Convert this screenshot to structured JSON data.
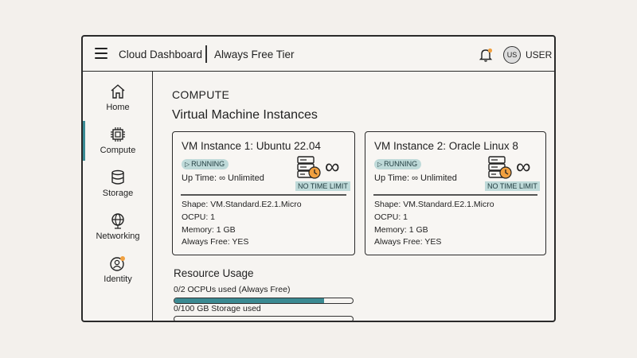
{
  "header": {
    "app_title": "Cloud Dashboard",
    "tier_label": "Always Free Tier",
    "user_initials": "US",
    "user_label": "USER"
  },
  "sidebar": {
    "items": [
      {
        "label": "Home",
        "icon": "home-icon",
        "active": false
      },
      {
        "label": "Compute",
        "icon": "cpu-chip-icon",
        "active": true
      },
      {
        "label": "Storage",
        "icon": "database-icon",
        "active": false
      },
      {
        "label": "Networking",
        "icon": "globe-icon",
        "active": false
      },
      {
        "label": "Identity",
        "icon": "user-badge-icon",
        "active": false
      }
    ]
  },
  "main": {
    "section_title": "COMPUTE",
    "subsection_title": "Virtual Machine Instances",
    "instances": [
      {
        "name": "VM Instance 1: Ubuntu 22.04",
        "status": "RUNNING",
        "uptime": "Up Time: ∞ Unlimited",
        "limit_badge": "NO TIME LIMIT",
        "shape": "Shape: VM.Standard.E2.1.Micro",
        "ocpu": "OCPU: 1",
        "memory": "Memory: 1 GB",
        "always_free": "Always Free: YES"
      },
      {
        "name": "VM Instance 2: Oracle Linux 8",
        "status": "RUNNING",
        "uptime": "Up Time: ∞ Unlimited",
        "limit_badge": "NO TIME LIMIT",
        "shape": "Shape: VM.Standard.E2.1.Micro",
        "ocpu": "OCPU: 1",
        "memory": "Memory: 1 GB",
        "always_free": "Always Free: YES"
      }
    ],
    "resource_usage": {
      "title": "Resource Usage",
      "bars": [
        {
          "label": "0/2 OCPUs used (Always Free)",
          "fill": 0.84
        },
        {
          "label": "0/100 GB Storage used",
          "fill": 0
        }
      ]
    }
  },
  "colors": {
    "accent": "#3b8a92",
    "badge_bg": "#bfdad9",
    "notification_dot": "#f0a040"
  }
}
